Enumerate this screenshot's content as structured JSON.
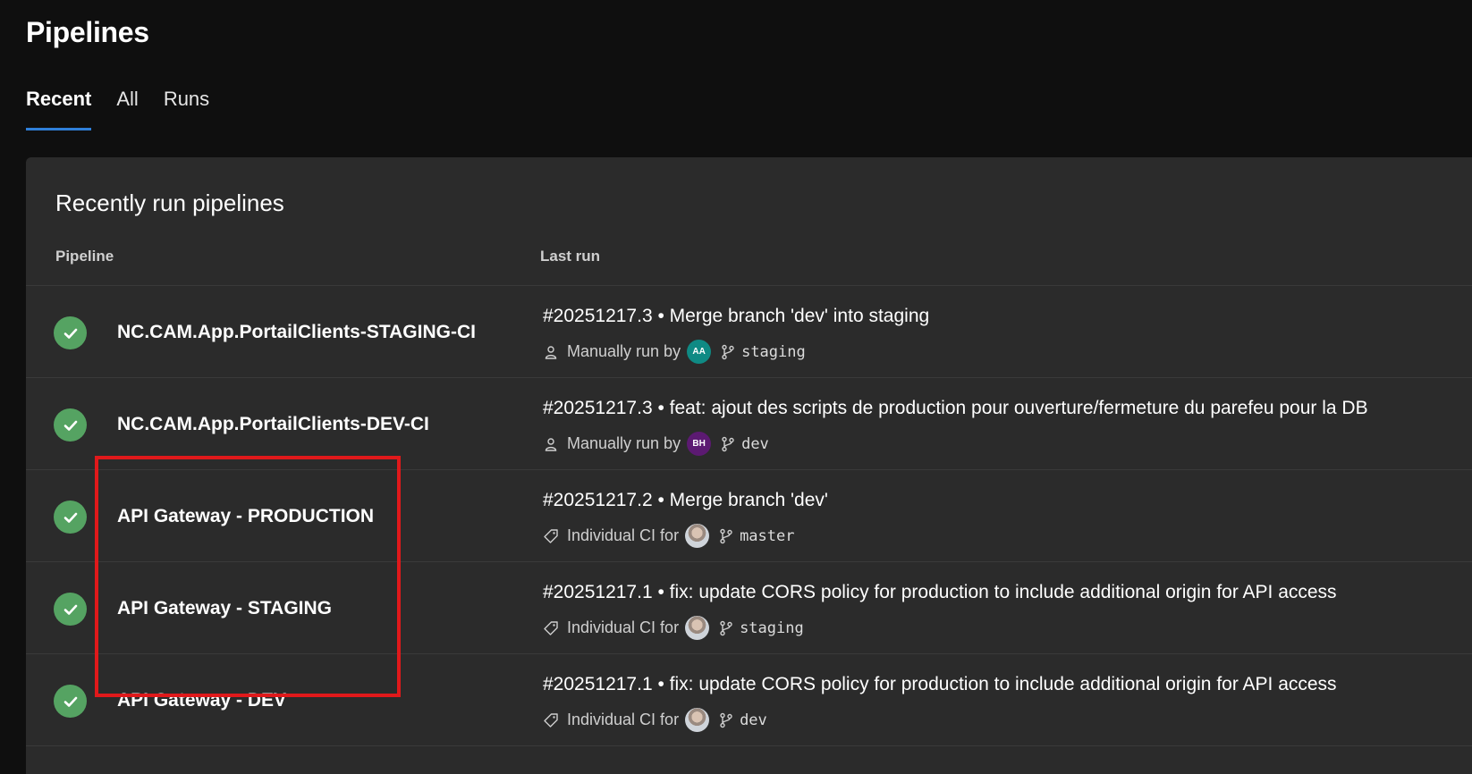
{
  "header": {
    "title": "Pipelines"
  },
  "tabs": [
    {
      "label": "Recent",
      "active": true
    },
    {
      "label": "All",
      "active": false
    },
    {
      "label": "Runs",
      "active": false
    }
  ],
  "panel": {
    "title": "Recently run pipelines",
    "columns": {
      "pipeline": "Pipeline",
      "last_run": "Last run"
    }
  },
  "rows": [
    {
      "name": "NC.CAM.App.PortailClients-STAGING-CI",
      "run": "#20251217.3 • Merge branch 'dev' into staging",
      "trigger_icon": "user-icon",
      "trigger": "Manually run by",
      "avatar": "AA",
      "avatar_color": "#0f8a84",
      "branch": "staging"
    },
    {
      "name": "NC.CAM.App.PortailClients-DEV-CI",
      "run": "#20251217.3 • feat: ajout des scripts de production pour ouverture/fermeture du parefeu pour la DB",
      "trigger_icon": "user-icon",
      "trigger": "Manually run by",
      "avatar": "BH",
      "avatar_color": "#5c1a72",
      "branch": "dev"
    },
    {
      "name": "API Gateway - PRODUCTION",
      "run": "#20251217.2 • Merge branch 'dev'",
      "trigger_icon": "tag-icon",
      "trigger": "Individual CI for",
      "avatar": "",
      "avatar_color": "",
      "branch": "master"
    },
    {
      "name": "API Gateway - STAGING",
      "run": "#20251217.1 • fix: update CORS policy for production to include additional origin for API access",
      "trigger_icon": "tag-icon",
      "trigger": "Individual CI for",
      "avatar": "",
      "avatar_color": "",
      "branch": "staging"
    },
    {
      "name": "API Gateway - DEV",
      "run": "#20251217.1 • fix: update CORS policy for production to include additional origin for API access",
      "trigger_icon": "tag-icon",
      "trigger": "Individual CI for",
      "avatar": "",
      "avatar_color": "",
      "branch": "dev"
    }
  ],
  "colors": {
    "success": "#55a362",
    "accent": "#2f7fd9",
    "highlight": "#e0191b"
  }
}
